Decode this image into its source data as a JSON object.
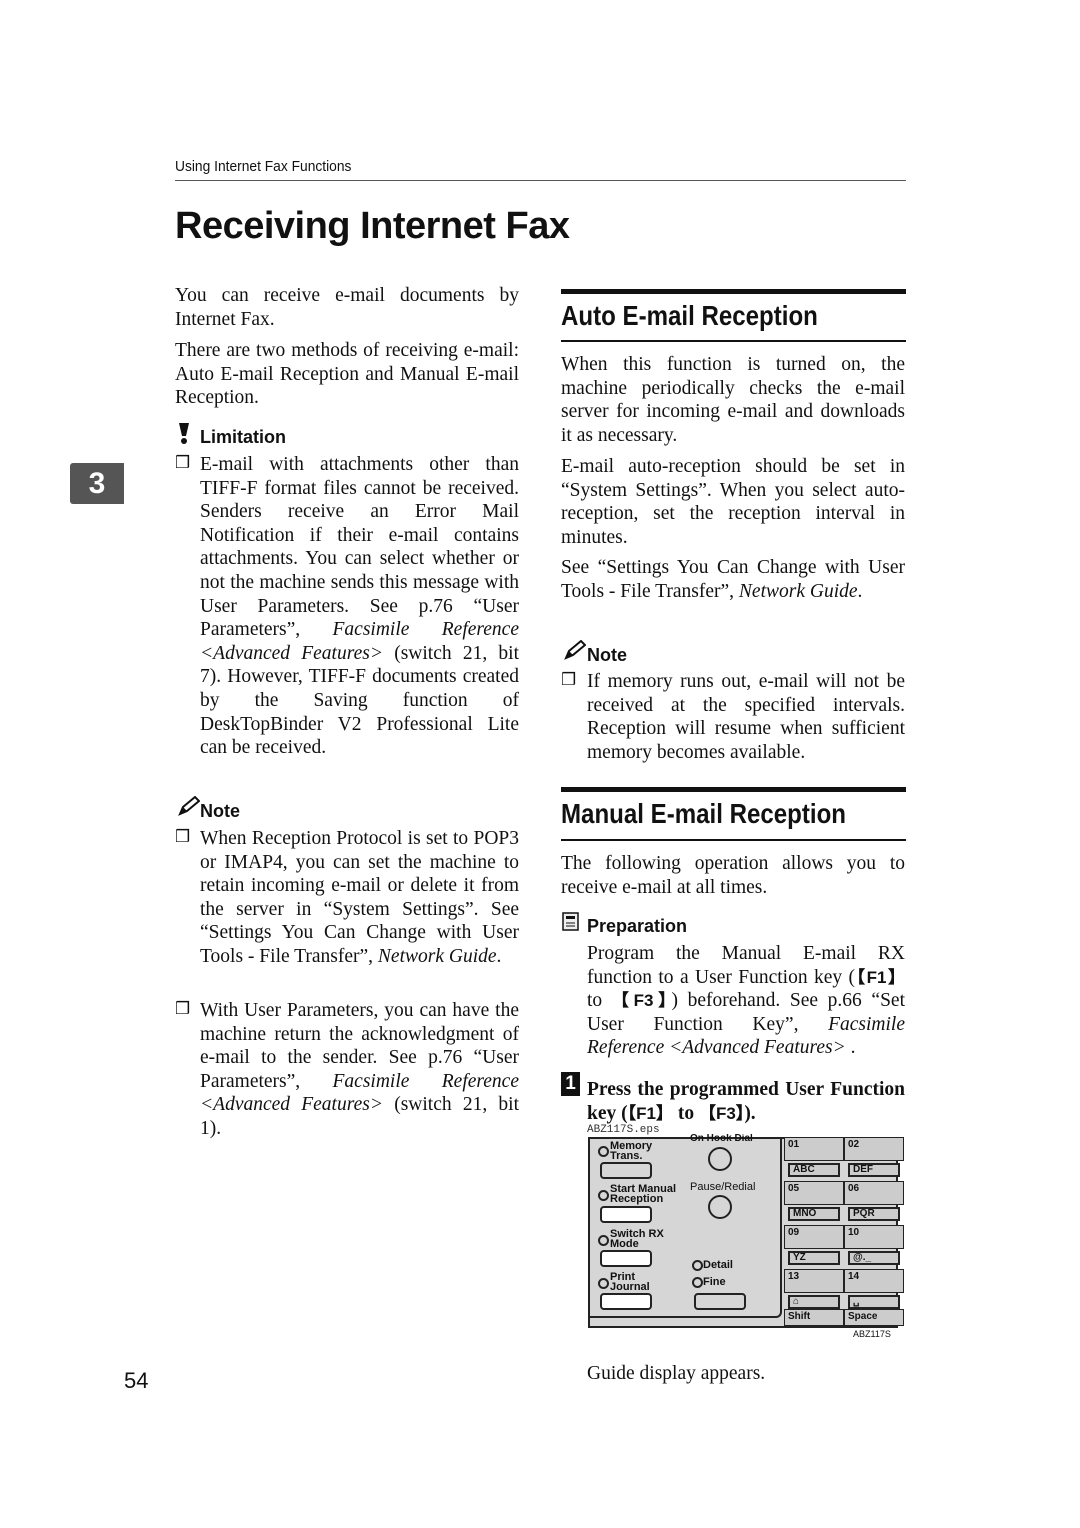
{
  "header": {
    "running_head": "Using Internet Fax Functions",
    "title": "Receiving Internet Fax",
    "chapter_tab": "3",
    "page_number": "54"
  },
  "left": {
    "intro1": [
      {
        "t": "You can receive e-mail documents by Internet Fax."
      }
    ],
    "intro2": [
      {
        "t": "There are two methods of receiving e-mail: Auto E-mail Reception and Manual E-mail Reception."
      }
    ],
    "limitation_label": "Limitation",
    "limitation_item": [
      {
        "t": "E-mail with attachments other than TIFF-F format files cannot be received. Senders receive an Error Mail Notification if their e-mail contains attachments. You can select whether or not the machine sends this message with User Parameters. See p.76 “User Parameters”, "
      },
      {
        "t": "Facsimile Reference <Advanced Features>",
        "i": true
      },
      {
        "t": " (switch 21, bit 7). However, TIFF-F documents created by the Saving function of DeskTopBinder V2 Professional Lite can be received."
      }
    ],
    "note_label": "Note",
    "note_item1": [
      {
        "t": "When Reception Protocol is set to POP3 or IMAP4, you can set the machine to retain incoming e-mail or delete it from the server in “System Settings”. See “Settings You Can Change with User Tools - File Transfer”, "
      },
      {
        "t": "Network Guide",
        "i": true
      },
      {
        "t": "."
      }
    ],
    "note_item2": [
      {
        "t": "With User Parameters, you can have the machine return the acknowledgment of e-mail to the sender. See p.76 “User Parameters”, "
      },
      {
        "t": "Facsimile Reference <Advanced Features>",
        "i": true
      },
      {
        "t": " (switch 21, bit 1)."
      }
    ]
  },
  "right": {
    "auto_heading": "Auto E-mail Reception",
    "auto_p1": [
      {
        "t": "When this function is turned on, the machine periodically checks the e-mail server for incoming e-mail and downloads it as necessary."
      }
    ],
    "auto_p2": [
      {
        "t": "E-mail auto-reception should be set in “System Settings”. When you select auto-reception, set the reception interval in minutes."
      }
    ],
    "auto_p3": [
      {
        "t": "See “Settings You Can Change with User Tools - File Transfer”, "
      },
      {
        "t": "Network Guide",
        "i": true
      },
      {
        "t": "."
      }
    ],
    "note_label": "Note",
    "note_item": [
      {
        "t": "If memory runs out, e-mail will not be received at the specified intervals. Reception will resume when sufficient memory becomes available."
      }
    ],
    "manual_heading": "Manual E-mail Reception",
    "manual_p1": [
      {
        "t": "The following operation allows you to receive e-mail at all times."
      }
    ],
    "prep_label": "Preparation",
    "prep_text": [
      {
        "t": "Program the Manual E-mail RX function to a User Function key ("
      },
      {
        "t": "【F1】",
        "k": true
      },
      {
        "t": " to "
      },
      {
        "t": "【F3】",
        "k": true
      },
      {
        "t": ") beforehand. See p.66 “Set User Function Key”, "
      },
      {
        "t": "Facsimile Reference <Advanced Features>",
        "i": true
      },
      {
        "t": " ."
      }
    ],
    "step_number": "1",
    "step1": [
      {
        "t": "Press the programmed User Function key ("
      },
      {
        "t": "【F1】",
        "k": true
      },
      {
        "t": " to "
      },
      {
        "t": "【F3】",
        "k": true
      },
      {
        "t": ")."
      }
    ],
    "figure_file": "ABZ117S.eps",
    "figure_id": "ABZ117S",
    "step1_result": "Guide display appears."
  },
  "panel": {
    "memory_trans": "Memory Trans.",
    "start_manual": "Start Manual Reception",
    "switch_rx": "Switch RX Mode",
    "print_journal": "Print Journal",
    "on_hook": "On Hook Dial",
    "pause_redial": "Pause/Redial",
    "detail": "Detail",
    "fine": "Fine",
    "quick_dial": [
      "01",
      "02",
      "05",
      "06",
      "09",
      "10",
      "13",
      "14"
    ],
    "letter_keys": [
      "ABC",
      "DEF",
      "MNO",
      "PQR",
      "YZ",
      "@._",
      "⌂",
      "␣"
    ],
    "shift": "Shift",
    "space": "Space"
  }
}
